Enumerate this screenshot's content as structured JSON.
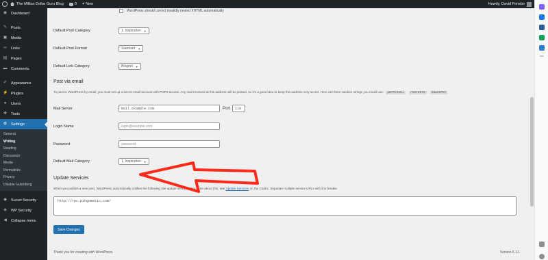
{
  "adminbar": {
    "site_name": "The Million Dollar Guru Blog",
    "comments_count": "0",
    "new_label": "New",
    "howdy": "Howdy, David Fonsbo"
  },
  "sidebar": {
    "items": [
      {
        "label": "Dashboard",
        "icon": "dashboard-icon",
        "glyph": "◉"
      },
      {
        "label": "Posts",
        "icon": "pin-icon",
        "glyph": "✎"
      },
      {
        "label": "Media",
        "icon": "media-icon",
        "glyph": "▣"
      },
      {
        "label": "Links",
        "icon": "link-icon",
        "glyph": "∞"
      },
      {
        "label": "Pages",
        "icon": "page-icon",
        "glyph": "▤"
      },
      {
        "label": "Comments",
        "icon": "comment-icon",
        "glyph": "▬"
      },
      {
        "label": "Appearance",
        "icon": "brush-icon",
        "glyph": "✐"
      },
      {
        "label": "Plugins",
        "icon": "plugin-icon",
        "glyph": "⚡"
      },
      {
        "label": "Users",
        "icon": "user-icon",
        "glyph": "●"
      },
      {
        "label": "Tools",
        "icon": "wrench-icon",
        "glyph": "✚"
      },
      {
        "label": "Settings",
        "icon": "settings-icon",
        "glyph": "⚙"
      },
      {
        "label": "Sucuri Security",
        "icon": "sucuri-icon",
        "glyph": "◆"
      },
      {
        "label": "WP Security",
        "icon": "shield-icon",
        "glyph": "◈"
      },
      {
        "label": "Collapse menu",
        "icon": "collapse-icon",
        "glyph": "◀"
      }
    ],
    "submenu": [
      "General",
      "Writing",
      "Reading",
      "Discussion",
      "Media",
      "Permalinks",
      "Privacy",
      "Disable Gutenberg"
    ]
  },
  "form": {
    "xhtml_checkbox_label": "WordPress should correct invalidly nested XHTML automatically",
    "default_post_category_label": "Default Post Category",
    "default_post_category_value": "1. Inspiration",
    "default_post_format_label": "Default Post Format",
    "default_post_format_value": "Standard",
    "default_link_category_label": "Default Link Category",
    "default_link_category_value": "Blogroll",
    "post_via_email_heading": "Post via email",
    "post_via_email_desc": "To post to WordPress by email, you must set up a secret email account with POP3 access. Any mail received at this address will be posted, so it's a good idea to keep this address very secret. Here are three random strings you could use:",
    "random_strings": [
      "pB7Pz9eKi",
      "rS2tUb7G",
      "kNw5hP9Y"
    ],
    "mail_server_label": "Mail Server",
    "mail_server_value": "mail.example.com",
    "port_label": "Port",
    "port_value": "110",
    "login_name_label": "Login Name",
    "login_name_placeholder": "login@example.com",
    "password_label": "Password",
    "password_placeholder": "password",
    "default_mail_category_label": "Default Mail Category",
    "default_mail_category_value": "1. Inspiration",
    "update_services_heading": "Update Services",
    "update_services_desc_pre": "When you publish a new post, WordPress automatically notifies the following site update services. For more about this, see",
    "update_services_link": "Update Services",
    "update_services_desc_post": "on the Codex. Separate multiple service URLs with line breaks.",
    "ping_sites_value": "http://rpc.pingomatic.com/",
    "save_button": "Save Changes"
  },
  "footer": {
    "thanks": "Thank you for creating with WordPress.",
    "version": "Version 6.1.1"
  },
  "colors": {
    "admin_dark": "#1d2327",
    "accent": "#2271b1",
    "annotation_arrow": "#ff2a1a"
  }
}
